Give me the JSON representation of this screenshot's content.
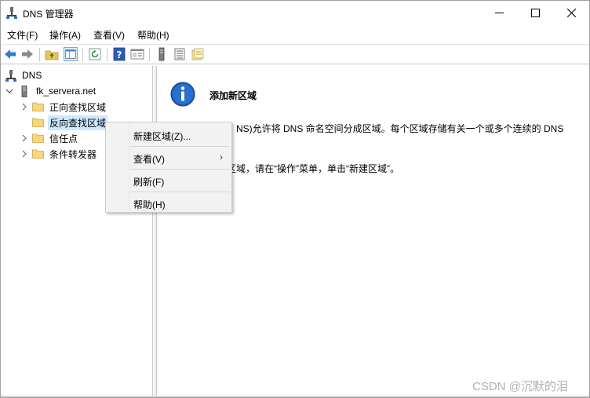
{
  "window": {
    "title": "DNS 管理器",
    "controls": {
      "minimize": "—",
      "maximize": "☐",
      "close": "✕"
    }
  },
  "menubar": [
    {
      "label": "文件(F)"
    },
    {
      "label": "操作(A)"
    },
    {
      "label": "查看(V)"
    },
    {
      "label": "帮助(H)"
    }
  ],
  "toolbar": {
    "icons": [
      "back-arrow-icon",
      "forward-arrow-icon",
      "up-folder-icon",
      "show-hide-tree-icon",
      "refresh-icon",
      "help-icon",
      "properties-icon",
      "server-icon",
      "list-icon",
      "folder-icon"
    ]
  },
  "tree": {
    "root": "DNS",
    "server": "fk_servera.net",
    "children": [
      {
        "label": "正向查找区域"
      },
      {
        "label": "反向查找区域"
      },
      {
        "label": "信任点"
      },
      {
        "label": "条件转发器"
      }
    ]
  },
  "context_menu": {
    "items": [
      {
        "label": "新建区域(Z)..."
      },
      {
        "label": "查看(V)"
      },
      {
        "label": "刷新(F)"
      },
      {
        "label": "帮助(H)"
      }
    ],
    "submenu_arrow": "›"
  },
  "content": {
    "heading": "添加新区域",
    "line1": "NS)允许将 DNS 命名空间分成区域。每个区域存储有关一个或多个连续的 DNS",
    "line3": "区域，请在“操作”菜单，单击“新建区域”。"
  },
  "watermark": "CSDN @沉默的泪",
  "colors": {
    "selection": "#cce8ff",
    "menu_bg": "#f2f2f2",
    "info_blue": "#1c5fb8"
  }
}
